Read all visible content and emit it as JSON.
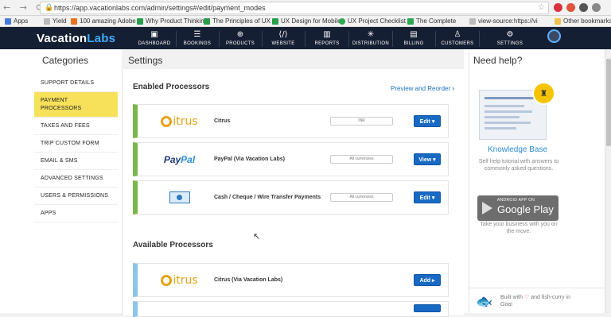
{
  "browser": {
    "url": "https://app.vacationlabs.com/admin/settings#/edit/payment_modes",
    "bookmarks": [
      "Apps",
      "Yield",
      "100 amazing Adobe I",
      "Why Product Thinkin",
      "The Principles of UX C",
      "UX Design for Mobile",
      "UX Project Checklist",
      "The Complete",
      "view-source:https://vi",
      "Other bookmarks"
    ]
  },
  "brand": {
    "name_part1": "Vacation",
    "name_part2": "Labs"
  },
  "topnav": {
    "items": [
      {
        "label": "DASHBOARD",
        "icon": "dashboard-icon"
      },
      {
        "label": "BOOKINGS",
        "icon": "bookings-icon"
      },
      {
        "label": "PRODUCTS",
        "icon": "products-icon"
      },
      {
        "label": "WEBSITE",
        "icon": "website-icon"
      },
      {
        "label": "REPORTS",
        "icon": "reports-icon"
      },
      {
        "label": "DISTRIBUTION",
        "icon": "distribution-icon"
      },
      {
        "label": "BILLING",
        "icon": "billing-icon"
      },
      {
        "label": "CUSTOMERS",
        "icon": "customers-icon"
      },
      {
        "label": "SETTINGS",
        "icon": "gear-icon"
      }
    ]
  },
  "sidebar": {
    "heading": "Categories",
    "items": [
      {
        "label": "SUPPORT DETAILS"
      },
      {
        "label": "PAYMENT PROCESSORS"
      },
      {
        "label": "TAXES AND FEES"
      },
      {
        "label": "TRIP CUSTOM FORM"
      },
      {
        "label": "EMAIL & SMS"
      },
      {
        "label": "ADVANCED SETTINGS"
      },
      {
        "label": "USERS & PERMISSIONS"
      },
      {
        "label": "APPS"
      }
    ]
  },
  "main": {
    "heading": "Settings",
    "enabled_title": "Enabled Processors",
    "preview_link": "Preview and Reorder",
    "enabled": [
      {
        "name": "Citrus",
        "logo": "citrus",
        "field": "INR",
        "button": "Edit ▾"
      },
      {
        "name": "PayPal (Via Vacation Labs)",
        "logo": "paypal",
        "field": "All currencies",
        "button": "View ▾"
      },
      {
        "name": "Cash / Cheque / Wire Transfer Payments",
        "logo": "money",
        "field": "All currencies",
        "button": "Edit ▾"
      }
    ],
    "available_title": "Available Processors",
    "available": [
      {
        "name": "Citrus (Via Vacation Labs)",
        "logo": "citrus",
        "button": "Add ▸"
      }
    ],
    "logo_texts": {
      "citrus": "itrus",
      "paypal_1": "Pay",
      "paypal_2": "Pal"
    }
  },
  "help": {
    "heading": "Need help?",
    "kb_title": "Knowledge Base",
    "kb_desc": "Self help tutorial with answers to commonly asked questions.",
    "gplay_small": "ANDROID APP ON",
    "gplay_big": "Google Play",
    "gplay_desc": "Take your business with you on the move.",
    "credit_1": "Built with",
    "credit_2": "and fish-curry in Goa!"
  },
  "colors": {
    "accent": "#1769c4",
    "active_bg": "#f7e15a",
    "enabled_border": "#7ab648",
    "available_border": "#8cc4ec",
    "nav_bg": "#151f33"
  }
}
